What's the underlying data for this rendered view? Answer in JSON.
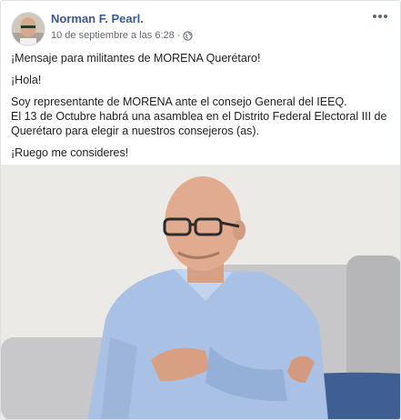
{
  "post": {
    "author": "Norman F. Pearl.",
    "timestamp": "10 de septiembre a las 6:28",
    "separator": "·",
    "more_icon": "more-options-icon",
    "privacy_icon": "globe-icon",
    "paragraphs": {
      "p1": "¡Mensaje para militantes de MORENA Querétaro!",
      "p2": "¡Hola!",
      "p3_l1": "Soy representante de MORENA ante el consejo General del IEEQ.",
      "p3_l2": "El 13 de Octubre habrá una asamblea en el Distrito Federal Electoral III de",
      "p3_l3": "Querétaro para elegir a nuestros consejeros (as).",
      "p4": "¡Ruego me consideres!"
    }
  }
}
